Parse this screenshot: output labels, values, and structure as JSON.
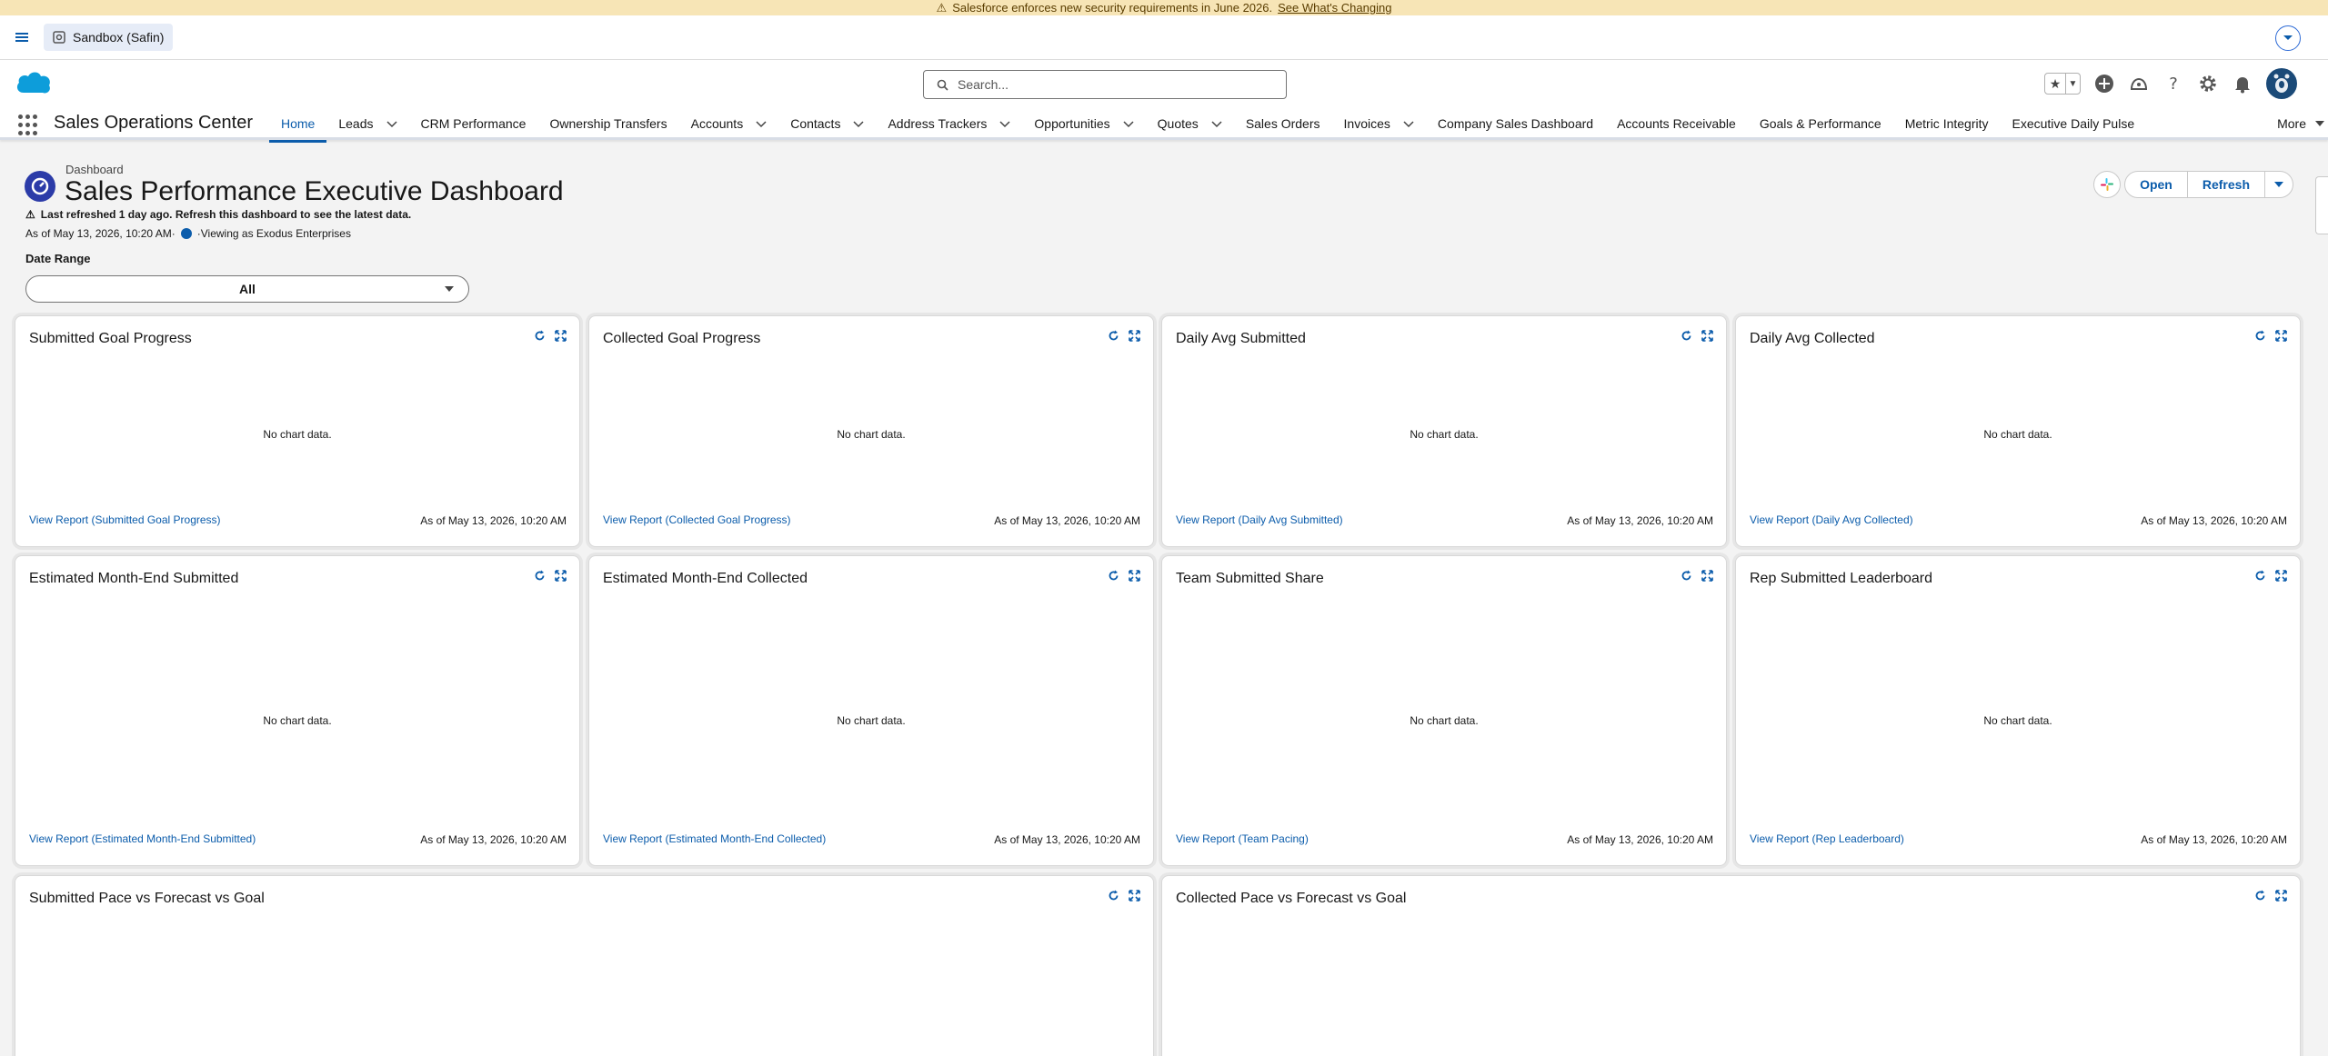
{
  "banner": {
    "message": "Salesforce enforces new security requirements in June 2026.",
    "link": "See What's Changing"
  },
  "sandbox": {
    "label": "Sandbox (Safin)"
  },
  "header": {
    "search_placeholder": "Search..."
  },
  "app": {
    "name": "Sales Operations Center",
    "nav": [
      {
        "label": "Home",
        "dropdown": false,
        "active": true
      },
      {
        "label": "Leads",
        "dropdown": true
      },
      {
        "label": "CRM Performance",
        "dropdown": false
      },
      {
        "label": "Ownership Transfers",
        "dropdown": false
      },
      {
        "label": "Accounts",
        "dropdown": true
      },
      {
        "label": "Contacts",
        "dropdown": true
      },
      {
        "label": "Address Trackers",
        "dropdown": true
      },
      {
        "label": "Opportunities",
        "dropdown": true
      },
      {
        "label": "Quotes",
        "dropdown": true
      },
      {
        "label": "Sales Orders",
        "dropdown": false
      },
      {
        "label": "Invoices",
        "dropdown": true
      },
      {
        "label": "Company Sales Dashboard",
        "dropdown": false
      },
      {
        "label": "Accounts Receivable",
        "dropdown": false
      },
      {
        "label": "Goals & Performance",
        "dropdown": false
      },
      {
        "label": "Metric Integrity",
        "dropdown": false
      },
      {
        "label": "Executive Daily Pulse",
        "dropdown": false
      }
    ],
    "more_label": "More"
  },
  "dashboard": {
    "eyebrow": "Dashboard",
    "title": "Sales Performance Executive Dashboard",
    "refresh_note": "Last refreshed 1 day ago. Refresh this dashboard to see the latest data.",
    "as_of": "As of May 13, 2026, 10:20 AM·",
    "viewing_as": "·Viewing as Exodus Enterprises",
    "date_range_label": "Date Range",
    "date_range_value": "All",
    "open_label": "Open",
    "refresh_label": "Refresh"
  },
  "no_data_text": "No chart data.",
  "cards": [
    {
      "title": "Submitted Goal Progress",
      "link": "View Report (Submitted Goal Progress)",
      "as_of": "As of May 13, 2026, 10:20 AM"
    },
    {
      "title": "Collected Goal Progress",
      "link": "View Report (Collected Goal Progress)",
      "as_of": "As of May 13, 2026, 10:20 AM"
    },
    {
      "title": "Daily Avg Submitted",
      "link": "View Report (Daily Avg Submitted)",
      "as_of": "As of May 13, 2026, 10:20 AM"
    },
    {
      "title": "Daily Avg Collected",
      "link": "View Report (Daily Avg Collected)",
      "as_of": "As of May 13, 2026, 10:20 AM"
    },
    {
      "title": "Estimated Month-End Submitted",
      "link": "View Report (Estimated Month-End Submitted)",
      "as_of": "As of May 13, 2026, 10:20 AM"
    },
    {
      "title": "Estimated Month-End Collected",
      "link": "View Report (Estimated Month-End Collected)",
      "as_of": "As of May 13, 2026, 10:20 AM"
    },
    {
      "title": "Team Submitted Share",
      "link": "View Report (Team Pacing)",
      "as_of": "As of May 13, 2026, 10:20 AM"
    },
    {
      "title": "Rep Submitted Leaderboard",
      "link": "View Report (Rep Leaderboard)",
      "as_of": "As of May 13, 2026, 10:20 AM"
    },
    {
      "title": "Submitted Pace vs Forecast vs Goal"
    },
    {
      "title": "Collected Pace vs Forecast vs Goal"
    }
  ]
}
